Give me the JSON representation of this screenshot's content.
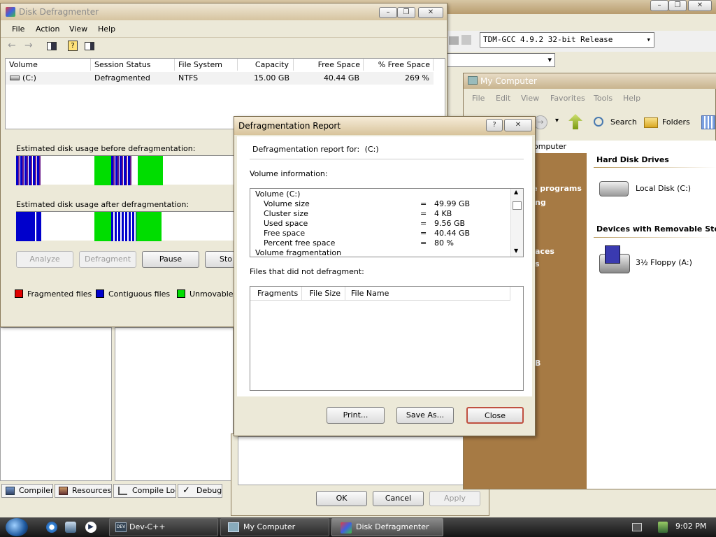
{
  "devcpp": {
    "compiler_select": "TDM-GCC 4.9.2 32-bit Release",
    "bottom_tabs": [
      "Compiler",
      "Resources",
      "Compile Log",
      "Debug"
    ],
    "dialog_buttons": {
      "ok": "OK",
      "cancel": "Cancel",
      "apply": "Apply"
    }
  },
  "my_computer": {
    "title": "My Computer",
    "menu": [
      "File",
      "Edit",
      "View",
      "Favorites",
      "Tools",
      "Help"
    ],
    "toolbar": {
      "search": "Search",
      "folders": "Folders"
    },
    "address_fragment": "omputer",
    "left_panel_fragments": [
      "e programs",
      "ng",
      "aces",
      "s",
      "B"
    ],
    "sections": {
      "hard_disks": "Hard Disk Drives",
      "removable": "Devices with Removable Storage"
    },
    "items": {
      "local_disk": "Local Disk (C:)",
      "floppy": "3½ Floppy (A:)"
    }
  },
  "defrag": {
    "title": "Disk Defragmenter",
    "menu": [
      "File",
      "Action",
      "View",
      "Help"
    ],
    "columns": [
      "Volume",
      "Session Status",
      "File System",
      "Capacity",
      "Free Space",
      "% Free Space"
    ],
    "row": {
      "volume": "(C:)",
      "status": "Defragmented",
      "fs": "NTFS",
      "capacity": "15.00 GB",
      "free": "40.44 GB",
      "pct": "269 %"
    },
    "before_label": "Estimated disk usage before defragmentation:",
    "after_label": "Estimated disk usage after defragmentation:",
    "buttons": {
      "analyze": "Analyze",
      "defragment": "Defragment",
      "pause": "Pause",
      "stop": "Sto"
    },
    "legend": {
      "fragmented": "Fragmented files",
      "contiguous": "Contiguous files",
      "unmovable": "Unmovable f"
    },
    "colors": {
      "fragmented": "#e00000",
      "contiguous": "#0000cc",
      "unmovable": "#00dd00",
      "dark": "#3a1a6a"
    }
  },
  "report": {
    "title": "Defragmentation Report",
    "report_for_label": "Defragmentation report for:",
    "report_for_value": "(C:)",
    "volume_info_label": "Volume information:",
    "volume_lines": [
      {
        "label": "Volume  (C:)",
        "eq": "",
        "value": ""
      },
      {
        "label": "Volume size",
        "eq": "=",
        "value": "49.99 GB"
      },
      {
        "label": "Cluster size",
        "eq": "=",
        "value": "4 KB"
      },
      {
        "label": "Used space",
        "eq": "=",
        "value": "9.56 GB"
      },
      {
        "label": "Free space",
        "eq": "=",
        "value": "40.44 GB"
      },
      {
        "label": "Percent free space",
        "eq": "=",
        "value": "80 %"
      },
      {
        "label": "Volume fragmentation",
        "eq": "",
        "value": ""
      }
    ],
    "files_label": "Files that did not defragment:",
    "file_columns": [
      "Fragments",
      "File Size",
      "File Name"
    ],
    "buttons": {
      "print": "Print...",
      "save_as": "Save As...",
      "close": "Close"
    }
  },
  "taskbar": {
    "items": [
      "Dev-C++",
      "My Computer",
      "Disk Defragmenter"
    ],
    "clock": "9:02 PM"
  }
}
